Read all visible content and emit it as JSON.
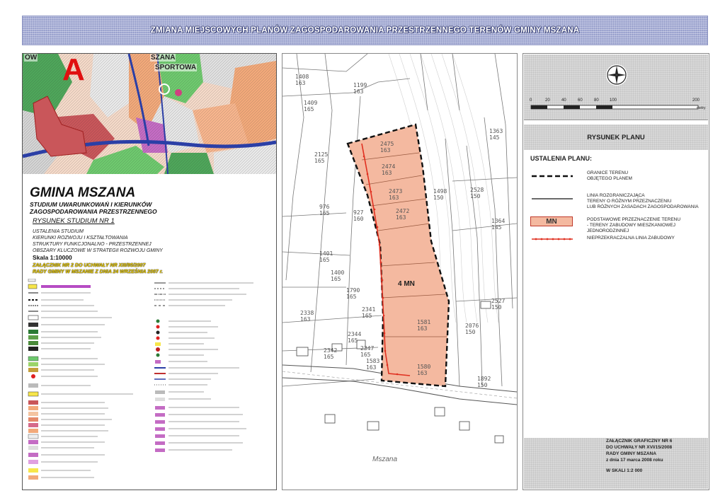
{
  "header": {
    "title": "ZMIANA MIEJSCOWYCH PLANÓW ZAGOSPODAROWANIA PRZESTRZENNEGO TERENÓW GMINY MSZANA"
  },
  "study": {
    "map_letter": "A",
    "map_labels": [
      "OW",
      "SZANA",
      "SPORTOWA"
    ],
    "title": "GMINA MSZANA",
    "subtitle": [
      "STUDIUM UWARUNKOWAŃ I KIERUNKÓW",
      "ZAGOSPODAROWANIA PRZESTRZENNEGO"
    ],
    "drawing": "RYSUNEK STUDIUM NR 1",
    "description": [
      "USTALENIA STUDIUM",
      "KIERUNKI ROZWOJU I KSZTAŁTOWANIA",
      "STRUKTURY FUNKCJONALNO - PRZESTRZENNEJ",
      "OBSZARY KLUCZOWE W STRATEGII ROZWOJU GMINY"
    ],
    "scale": "Skala 1:10000",
    "resolution": [
      "ZAŁĄCZNIK NR 2 DO UCHWAŁY NR XIII/95/2007",
      "RADY GMINY W MSZANIE Z DNIA 24 WRZEŚNIA 2007 r."
    ]
  },
  "plan": {
    "zone_label": "4 MN",
    "place_name": "Mszana",
    "parcels": [
      "1408\n163",
      "1199\n163",
      "1409\n165",
      "2475\n163",
      "2474\n163",
      "2473\n163",
      "2472\n163",
      "2125\n165",
      "976\n165",
      "927\n160",
      "1498\n150",
      "2528\n150",
      "1363\n145",
      "1364\n145",
      "1401\n165",
      "1400\n165",
      "1790\n165",
      "2341\n165",
      "2338\n163",
      "2344\n165",
      "2342\n165",
      "2347\n165",
      "1583\n163",
      "1581\n163",
      "1580\n163",
      "2527\n150",
      "2076\n150",
      "1892\n150"
    ]
  },
  "legend": {
    "title": "RYSUNEK PLANU",
    "ustalenia": "USTALENIA PLANU:",
    "items": [
      {
        "key": "boundary",
        "text": [
          "GRANICE TERENU",
          "OBJĘTEGO PLANEM"
        ]
      },
      {
        "key": "division",
        "text": [
          "LINIA ROZGRANICZAJĄCA",
          "TERENY O RÓŻNYM PRZEZNACZENIU",
          "LUB RÓŻNYCH ZASADACH ZAGOSPODAROWANIA"
        ]
      },
      {
        "key": "mn",
        "symbol": "MN",
        "text": [
          "PODSTAWOWE PRZEZNACZENIE TERENU",
          "- TERENY ZABUDOWY MIESZKANIOWEJ JEDNORODZINNEJ"
        ]
      },
      {
        "key": "building-line",
        "text": [
          "NIEPRZEKRACZALNA LINIA ZABUDOWY"
        ]
      }
    ],
    "scale_ticks": [
      "0",
      "20",
      "40",
      "60",
      "80",
      "100",
      "200"
    ],
    "scale_unit": "metry",
    "annex": [
      "ZAŁĄCZNIK GRAFICZNY NR 6",
      "DO UCHWAŁY NR XVI/15/2008",
      "RADY GMINY MSZANA",
      "z dnia 17 marca 2008 roku",
      "",
      "W SKALI 1:2 000"
    ]
  },
  "colors": {
    "mn_fill": "#f4b9a0",
    "boundary": "#111111",
    "building_line": "#e03020",
    "header": "#a7aed6"
  }
}
